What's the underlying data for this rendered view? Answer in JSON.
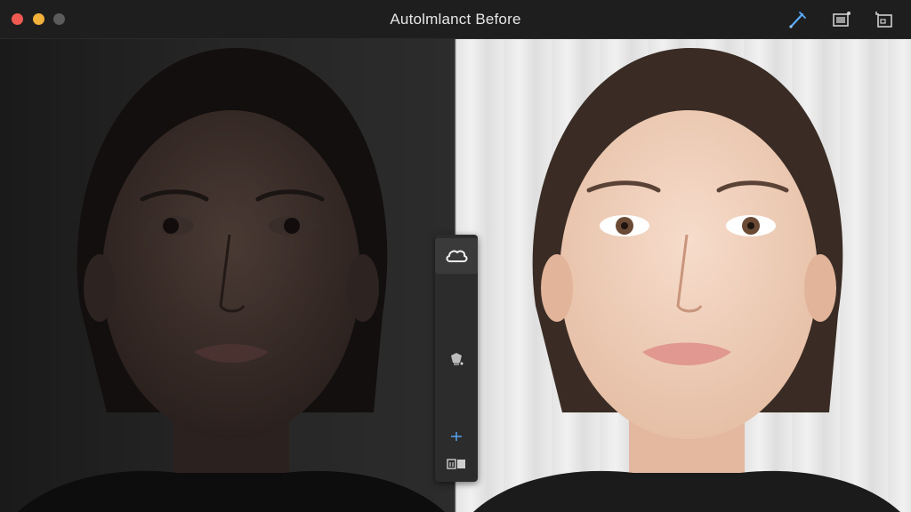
{
  "window": {
    "title": "Autolmlanct Before"
  },
  "toolbar": {
    "icons": [
      "brush-icon",
      "frame-icon",
      "crop-icon"
    ]
  },
  "tool_strip": {
    "tools": [
      "cloud-tool-icon",
      "stamp-tool-icon",
      "split-view-icon",
      "compare-view-icon"
    ]
  },
  "colors": {
    "close": "#ee5a52",
    "minimize": "#f2b13a",
    "maximize": "#5b5b5b",
    "accent": "#5aa9ff"
  }
}
